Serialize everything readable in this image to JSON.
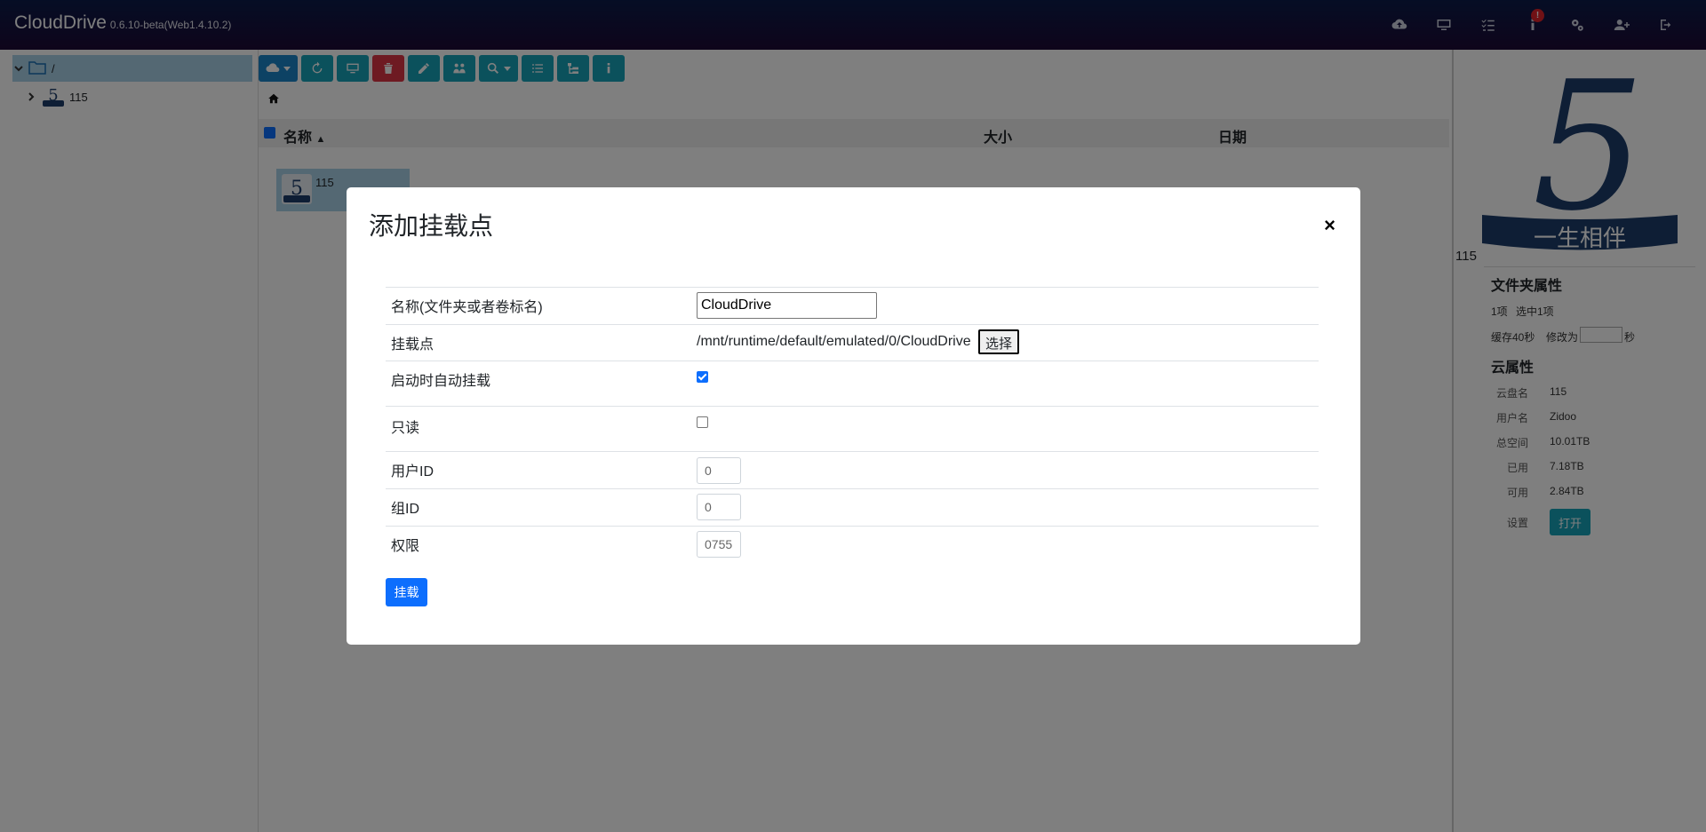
{
  "app": {
    "title": "CloudDrive",
    "version": "0.6.10-beta(Web1.4.10.2)"
  },
  "navbar": {
    "icons": [
      "cloud-upload-icon",
      "desktop-icon",
      "tasks-icon",
      "info-icon",
      "settings-icon",
      "add-user-icon",
      "logout-icon"
    ],
    "info_badge": "!"
  },
  "tree": {
    "root_label": "/",
    "items": [
      {
        "label": "115"
      }
    ]
  },
  "toolbar": {
    "buttons": [
      "cloud-menu",
      "refresh",
      "mount",
      "delete",
      "rename",
      "share",
      "search-menu",
      "list-view",
      "tree-view",
      "info"
    ]
  },
  "file_list": {
    "columns": {
      "name": "名称",
      "size": "大小",
      "date": "日期"
    },
    "items": [
      {
        "name": "115"
      }
    ]
  },
  "right_panel": {
    "logo_text": "一生相伴",
    "logo_number": "5",
    "name": "115",
    "folder_props": {
      "title": "文件夹属性",
      "count": "1项",
      "selected": "选中1项",
      "cache_label": "缓存40秒",
      "modify_label": "修改为",
      "seconds": "秒"
    },
    "cloud_props": {
      "title": "云属性",
      "rows": [
        {
          "key": "云盘名",
          "value": "115"
        },
        {
          "key": "用户名",
          "value": "Zidoo"
        },
        {
          "key": "总空间",
          "value": "10.01TB"
        },
        {
          "key": "已用",
          "value": "7.18TB"
        },
        {
          "key": "可用",
          "value": "2.84TB"
        }
      ],
      "settings_label": "设置",
      "open_button": "打开"
    }
  },
  "modal": {
    "title": "添加挂载点",
    "close": "×",
    "fields": {
      "name_label": "名称(文件夹或者卷标名)",
      "name_value": "CloudDrive",
      "mount_label": "挂载点",
      "mount_path": "/mnt/runtime/default/emulated/0/CloudDrive",
      "select_button": "选择",
      "automount_label": "启动时自动挂载",
      "automount_checked": true,
      "readonly_label": "只读",
      "readonly_checked": false,
      "uid_label": "用户ID",
      "uid_value": "0",
      "gid_label": "组ID",
      "gid_value": "0",
      "perm_label": "权限",
      "perm_value": "0755"
    },
    "submit": "挂载"
  }
}
